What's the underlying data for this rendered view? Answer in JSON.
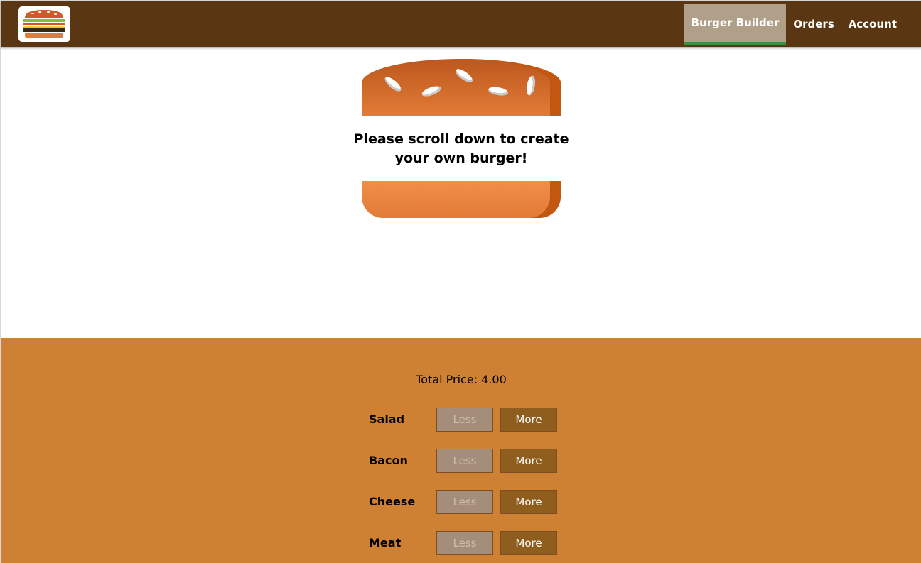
{
  "toolbar": {
    "logo_alt": "burger-logo",
    "nav": [
      {
        "label": "Burger Builder",
        "active": true
      },
      {
        "label": "Orders",
        "active": false
      },
      {
        "label": "Account",
        "active": false
      }
    ]
  },
  "burger": {
    "message": "Please scroll down to create your own burger!"
  },
  "controls": {
    "price_label": "Total Price: 4.00",
    "ingredients": [
      {
        "label": "Salad",
        "less": "Less",
        "more": "More"
      },
      {
        "label": "Bacon",
        "less": "Less",
        "more": "More"
      },
      {
        "label": "Cheese",
        "less": "Less",
        "more": "More"
      },
      {
        "label": "Meat",
        "less": "Less",
        "more": "More"
      }
    ]
  },
  "colors": {
    "toolbar": "#5a3712",
    "active_tab": "#b0a089",
    "active_underline": "#3e8f43",
    "controls_bg": "#cf8133",
    "less_button": "#a58e79",
    "more_button": "#8f5e1e"
  }
}
